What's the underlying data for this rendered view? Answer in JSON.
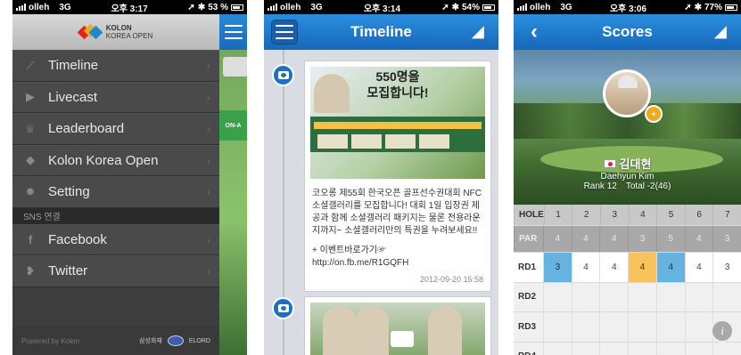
{
  "screen1": {
    "status": {
      "carrier": "olleh",
      "network": "3G",
      "time": "오후 3:17",
      "battery": "53 %"
    },
    "header": {
      "logo_top": "KOLON",
      "logo_bottom": "KOREA OPEN"
    },
    "menu": [
      {
        "label": "Timeline",
        "icon": "timeline-icon"
      },
      {
        "label": "Livecast",
        "icon": "livecast-icon"
      },
      {
        "label": "Leaderboard",
        "icon": "trophy-icon"
      },
      {
        "label": "Kolon Korea Open",
        "icon": "kolon-logo-icon"
      },
      {
        "label": "Setting",
        "icon": "gear-icon"
      }
    ],
    "sns_section": "SNS 연결",
    "sns": [
      {
        "label": "Facebook",
        "icon": "facebook-icon"
      },
      {
        "label": "Twitter",
        "icon": "twitter-icon"
      }
    ],
    "footer": {
      "powered": "Powered by Kolon",
      "sponsors": [
        "삼성화재",
        "ELORD"
      ]
    },
    "peek_badge": "ON-A"
  },
  "screen2": {
    "status": {
      "carrier": "olleh",
      "network": "3G",
      "time": "오후 3:14",
      "battery": "54%"
    },
    "title": "Timeline",
    "post": {
      "image_headline_1": "550명을",
      "image_headline_2": "모집합니다!",
      "body": "코오롱 제55회 한국오픈 골프선수권대회 NFC 소셜갤러리를 모집합니다! 대회 1일 입장권 제공과 함께 소셜갤러리 패키지는 물론 전용라운지까지~ 소셜갤러리만의 특권을 누려보세요!!",
      "link_label": "+ 이벤트바로가기☞",
      "link_url": "http://on.fb.me/R1GQFH",
      "date": "2012-09-20 15:58"
    }
  },
  "screen3": {
    "status": {
      "carrier": "olleh",
      "network": "3G",
      "time": "오후 3:06",
      "battery": "77%"
    },
    "title": "Scores",
    "back": "‹",
    "player": {
      "name_ko": "김대현",
      "name_en": "Daehyun Kim",
      "rank": "Rank 12",
      "total": "Total -2(46)"
    },
    "table": {
      "hole_label": "HOLE",
      "holes": [
        "1",
        "2",
        "3",
        "4",
        "5",
        "6",
        "7"
      ],
      "par_label": "PAR",
      "par": [
        "4",
        "4",
        "4",
        "3",
        "5",
        "4",
        "3"
      ],
      "rounds": [
        {
          "label": "RD1",
          "scores": [
            "3",
            "4",
            "4",
            "4",
            "4",
            "4",
            "3"
          ]
        },
        {
          "label": "RD2",
          "scores": [
            "",
            "",
            "",
            "",
            "",
            "",
            ""
          ]
        },
        {
          "label": "RD3",
          "scores": [
            "",
            "",
            "",
            "",
            "",
            "",
            ""
          ]
        },
        {
          "label": "RD4",
          "scores": [
            "",
            "",
            "",
            "",
            "",
            "",
            ""
          ]
        }
      ]
    },
    "colors": {
      "under_par": "#66b3e0",
      "over_par": "#f7c35a"
    }
  }
}
